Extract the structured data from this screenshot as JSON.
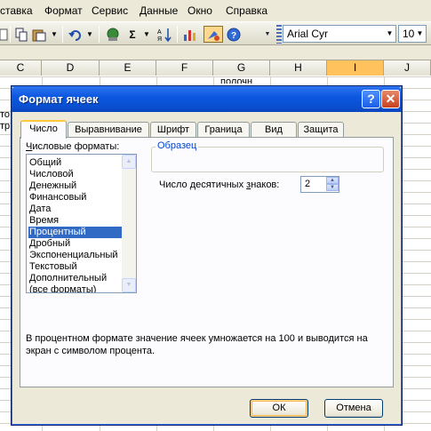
{
  "menubar": {
    "items": [
      "ставка",
      "Формат",
      "Сервис",
      "Данные",
      "Окно",
      "Справка"
    ]
  },
  "toolbar": {
    "font_name": "Arial Cyr",
    "font_size": "10",
    "sigma_label": "Σ",
    "icons": [
      "new-icon",
      "copy-icon",
      "paste-icon",
      "undo-icon",
      "hyperlink-icon",
      "autosum-icon",
      "sort-icon",
      "chart-wizard-icon",
      "drawing-icon",
      "help-icon"
    ]
  },
  "sheet": {
    "columns": [
      "C",
      "D",
      "E",
      "F",
      "G",
      "H",
      "I",
      "J"
    ],
    "active_column": "I",
    "fragments": [
      "полочн",
      "то",
      "тр"
    ]
  },
  "dialog": {
    "title": "Формат ячеек",
    "help_label": "?",
    "close_label": "✕",
    "tabs": [
      "Число",
      "Выравнивание",
      "Шрифт",
      "Граница",
      "Вид",
      "Защита"
    ],
    "active_tab": "Число",
    "formats_label_u": "Ч",
    "formats_label_rest": "исловые форматы:",
    "formats": [
      "Общий",
      "Числовой",
      "Денежный",
      "Финансовый",
      "Дата",
      "Время",
      "Процентный",
      "Дробный",
      "Экспоненциальный",
      "Текстовый",
      "Дополнительный",
      "(все форматы)"
    ],
    "selected_format": "Процентный",
    "sample_label": "Образец",
    "decimals_label_pre": "Число десятичных ",
    "decimals_label_u": "з",
    "decimals_label_post": "наков:",
    "decimals_value": "2",
    "description": "В процентном формате значение ячеек умножается на 100 и выводится на экран с символом процента.",
    "ok_label": "ОК",
    "cancel_label": "Отмена"
  },
  "colors": {
    "titlebar": "#0a4fd0",
    "selection": "#316ac5",
    "active_tab_accent": "#ffc83c",
    "active_column": "#ffc25d"
  }
}
